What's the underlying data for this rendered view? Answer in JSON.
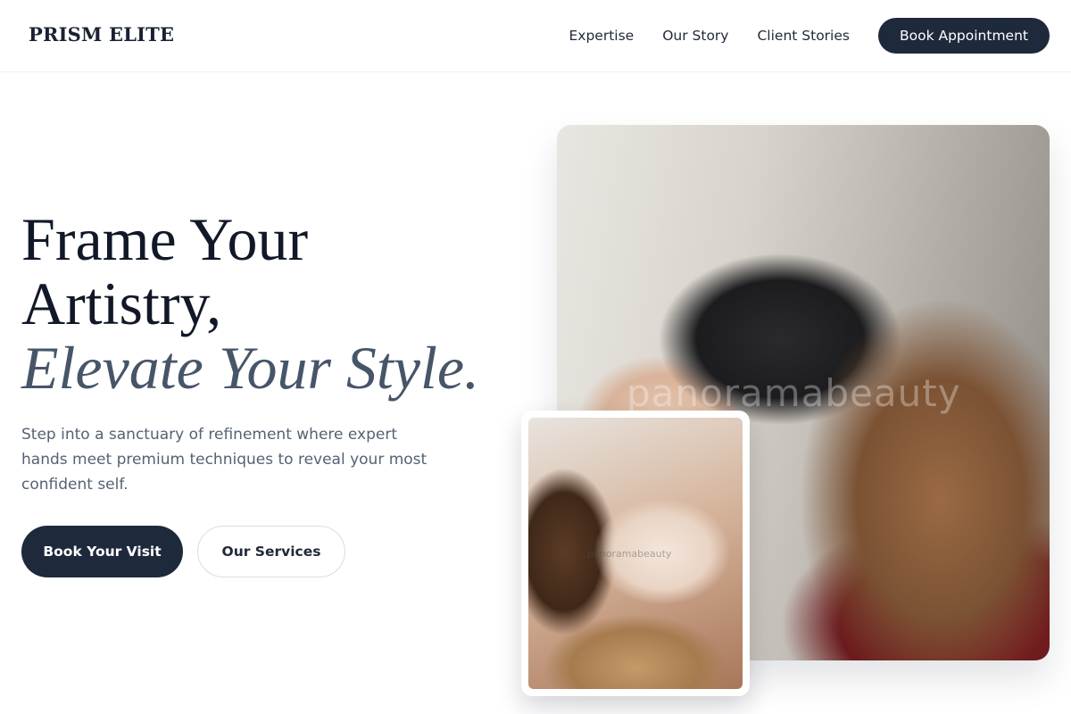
{
  "brand": "PRISM ELITE",
  "nav": {
    "items": [
      "Expertise",
      "Our Story",
      "Client Stories"
    ],
    "cta": "Book Appointment"
  },
  "hero": {
    "title_line1": "Frame Your",
    "title_line2": "Artistry,",
    "title_accent": "Elevate Your Style.",
    "description": "Step into a sanctuary of refinement where expert hands meet premium techniques to reveal your most confident self.",
    "primary_button": "Book Your Visit",
    "secondary_button": "Our Services"
  },
  "images": {
    "main_watermark": "panoramabeauty",
    "inset_watermark": "panoramabeauty"
  },
  "colors": {
    "primary": "#1e293b",
    "accent_text": "#475569"
  }
}
